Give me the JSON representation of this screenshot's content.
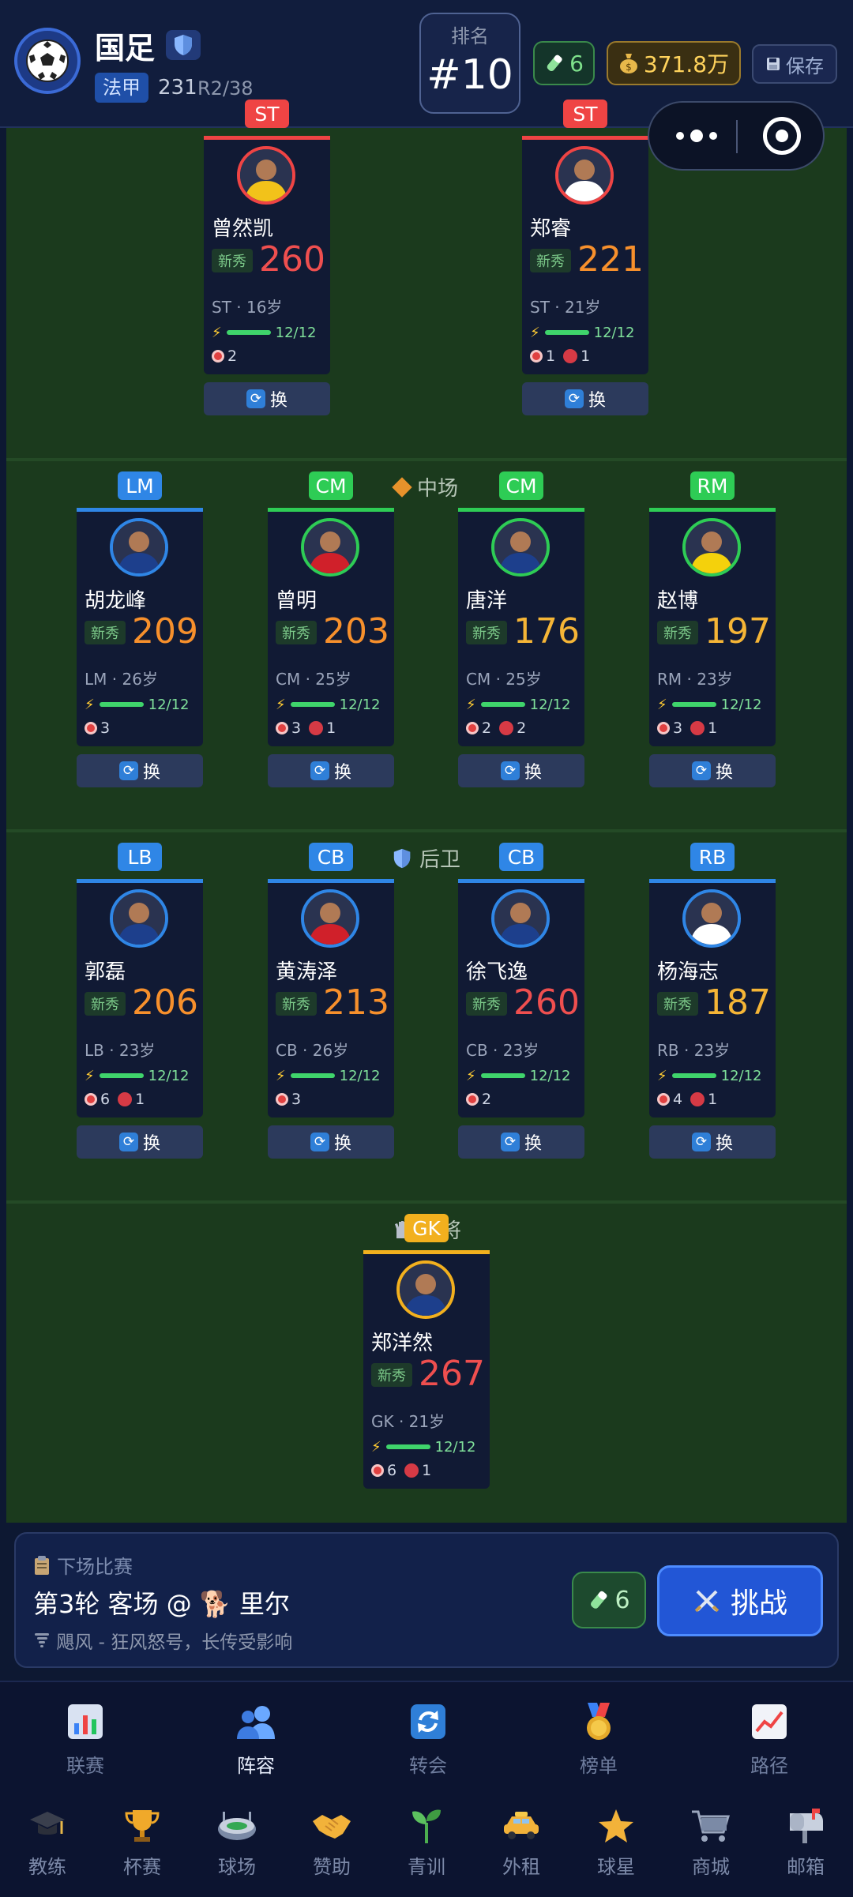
{
  "header": {
    "club_name": "国足",
    "league": "法甲",
    "points": "231",
    "round": "R2/38",
    "rank_label": "排名",
    "rank_value": "#10",
    "energy": "6",
    "money": "371.8万",
    "save_label": "保存"
  },
  "sections": {
    "midfield": "中场",
    "defense": "后卫",
    "goalkeeper": "门将"
  },
  "swap_label": "换",
  "rookie_label": "新秀",
  "colors": {
    "forward": "#ef4444",
    "midfield": "#2ecc55",
    "defense": "#2f86e6",
    "goalkeeper": "#f2b01e",
    "rating_red": "#ef4f4f",
    "rating_orange": "#f7902c",
    "rating_yellow": "#f5b536"
  },
  "players": {
    "st1": {
      "pos": "ST",
      "name": "曾然凯",
      "rating": "260",
      "meta": "ST · 16岁",
      "stamina": "12/12",
      "goals": "2",
      "cards": ""
    },
    "st2": {
      "pos": "ST",
      "name": "郑睿",
      "rating": "221",
      "meta": "ST · 21岁",
      "stamina": "12/12",
      "goals": "1",
      "cards": "1"
    },
    "lm": {
      "pos": "LM",
      "name": "胡龙峰",
      "rating": "209",
      "meta": "LM · 26岁",
      "stamina": "12/12",
      "goals": "3",
      "cards": ""
    },
    "cm1": {
      "pos": "CM",
      "name": "曾明",
      "rating": "203",
      "meta": "CM · 25岁",
      "stamina": "12/12",
      "goals": "3",
      "cards": "1"
    },
    "cm2": {
      "pos": "CM",
      "name": "唐洋",
      "rating": "176",
      "meta": "CM · 25岁",
      "stamina": "12/12",
      "goals": "2",
      "cards": "2"
    },
    "rm": {
      "pos": "RM",
      "name": "赵博",
      "rating": "197",
      "meta": "RM · 23岁",
      "stamina": "12/12",
      "goals": "3",
      "cards": "1"
    },
    "lb": {
      "pos": "LB",
      "name": "郭磊",
      "rating": "206",
      "meta": "LB · 23岁",
      "stamina": "12/12",
      "goals": "6",
      "cards": "1"
    },
    "cb1": {
      "pos": "CB",
      "name": "黄涛泽",
      "rating": "213",
      "meta": "CB · 26岁",
      "stamina": "12/12",
      "goals": "3",
      "cards": ""
    },
    "cb2": {
      "pos": "CB",
      "name": "徐飞逸",
      "rating": "260",
      "meta": "CB · 23岁",
      "stamina": "12/12",
      "goals": "2",
      "cards": ""
    },
    "rb": {
      "pos": "RB",
      "name": "杨海志",
      "rating": "187",
      "meta": "RB · 23岁",
      "stamina": "12/12",
      "goals": "4",
      "cards": "1"
    },
    "gk": {
      "pos": "GK",
      "name": "郑洋然",
      "rating": "267",
      "meta": "GK · 21岁",
      "stamina": "12/12",
      "goals": "6",
      "cards": "1"
    }
  },
  "next_match": {
    "header": "下场比赛",
    "title": "第3轮 客场 @ 🐕 里尔",
    "weather": "飓风 - 狂风怒号，长传受影响",
    "energy": "6",
    "challenge_label": "挑战"
  },
  "nav": {
    "main": [
      {
        "label": "联赛",
        "icon": "bar-chart-icon"
      },
      {
        "label": "阵容",
        "icon": "team-icon"
      },
      {
        "label": "转会",
        "icon": "refresh-icon"
      },
      {
        "label": "榜单",
        "icon": "medal-icon"
      },
      {
        "label": "路径",
        "icon": "trend-icon"
      }
    ],
    "tools": [
      {
        "label": "教练",
        "icon": "graduation-cap-icon"
      },
      {
        "label": "杯赛",
        "icon": "trophy-icon"
      },
      {
        "label": "球场",
        "icon": "stadium-icon"
      },
      {
        "label": "赞助",
        "icon": "handshake-icon"
      },
      {
        "label": "青训",
        "icon": "sprout-icon"
      },
      {
        "label": "外租",
        "icon": "taxi-icon"
      },
      {
        "label": "球星",
        "icon": "star-icon"
      },
      {
        "label": "商城",
        "icon": "cart-icon"
      },
      {
        "label": "邮箱",
        "icon": "mailbox-icon"
      }
    ]
  }
}
